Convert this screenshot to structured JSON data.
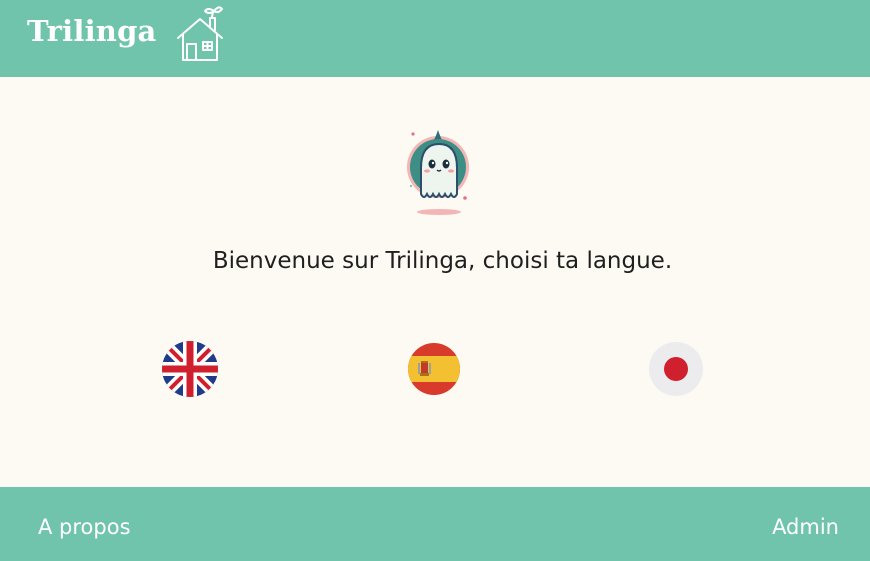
{
  "header": {
    "brand": "Trilinga",
    "home_icon": "house-with-sprout-icon"
  },
  "main": {
    "mascot_icon": "ghost-mascot-icon",
    "welcome_text": "Bienvenue sur Trilinga, choisi ta langue.",
    "languages": [
      {
        "code": "en",
        "icon": "uk-flag-icon"
      },
      {
        "code": "es",
        "icon": "spain-flag-icon"
      },
      {
        "code": "ja",
        "icon": "japan-flag-icon"
      }
    ]
  },
  "footer": {
    "about_label": "A propos",
    "admin_label": "Admin"
  },
  "colors": {
    "header_footer": "#70c4ac",
    "background": "#fdf9f3",
    "text": "#1f1f1f"
  }
}
